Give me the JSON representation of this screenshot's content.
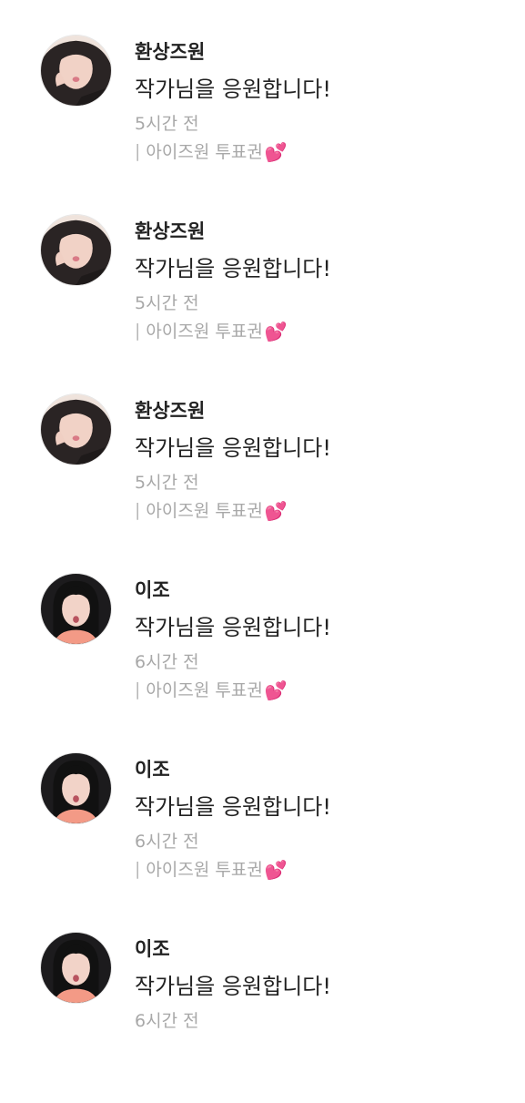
{
  "colors": {
    "text_primary": "#222222",
    "text_secondary": "#a8a8a8",
    "heart": "#ff3d8b"
  },
  "comments": [
    {
      "name": "환상즈원",
      "message": "작가님을 응원합니다!",
      "time": "5시간 전",
      "tag": "아이즈원 투표권",
      "tag_bar": "|",
      "tag_icon": "heart-icon",
      "avatar": "avatar-a"
    },
    {
      "name": "환상즈원",
      "message": "작가님을 응원합니다!",
      "time": "5시간 전",
      "tag": "아이즈원 투표권",
      "tag_bar": "|",
      "tag_icon": "heart-icon",
      "avatar": "avatar-a"
    },
    {
      "name": "환상즈원",
      "message": "작가님을 응원합니다!",
      "time": "5시간 전",
      "tag": "아이즈원 투표권",
      "tag_bar": "|",
      "tag_icon": "heart-icon",
      "avatar": "avatar-a"
    },
    {
      "name": "이조",
      "message": "작가님을 응원합니다!",
      "time": "6시간 전",
      "tag": "아이즈원 투표권",
      "tag_bar": "|",
      "tag_icon": "heart-icon",
      "avatar": "avatar-b"
    },
    {
      "name": "이조",
      "message": "작가님을 응원합니다!",
      "time": "6시간 전",
      "tag": "아이즈원 투표권",
      "tag_bar": "|",
      "tag_icon": "heart-icon",
      "avatar": "avatar-b"
    },
    {
      "name": "이조",
      "message": "작가님을 응원합니다!",
      "time": "6시간 전",
      "avatar": "avatar-b"
    }
  ]
}
